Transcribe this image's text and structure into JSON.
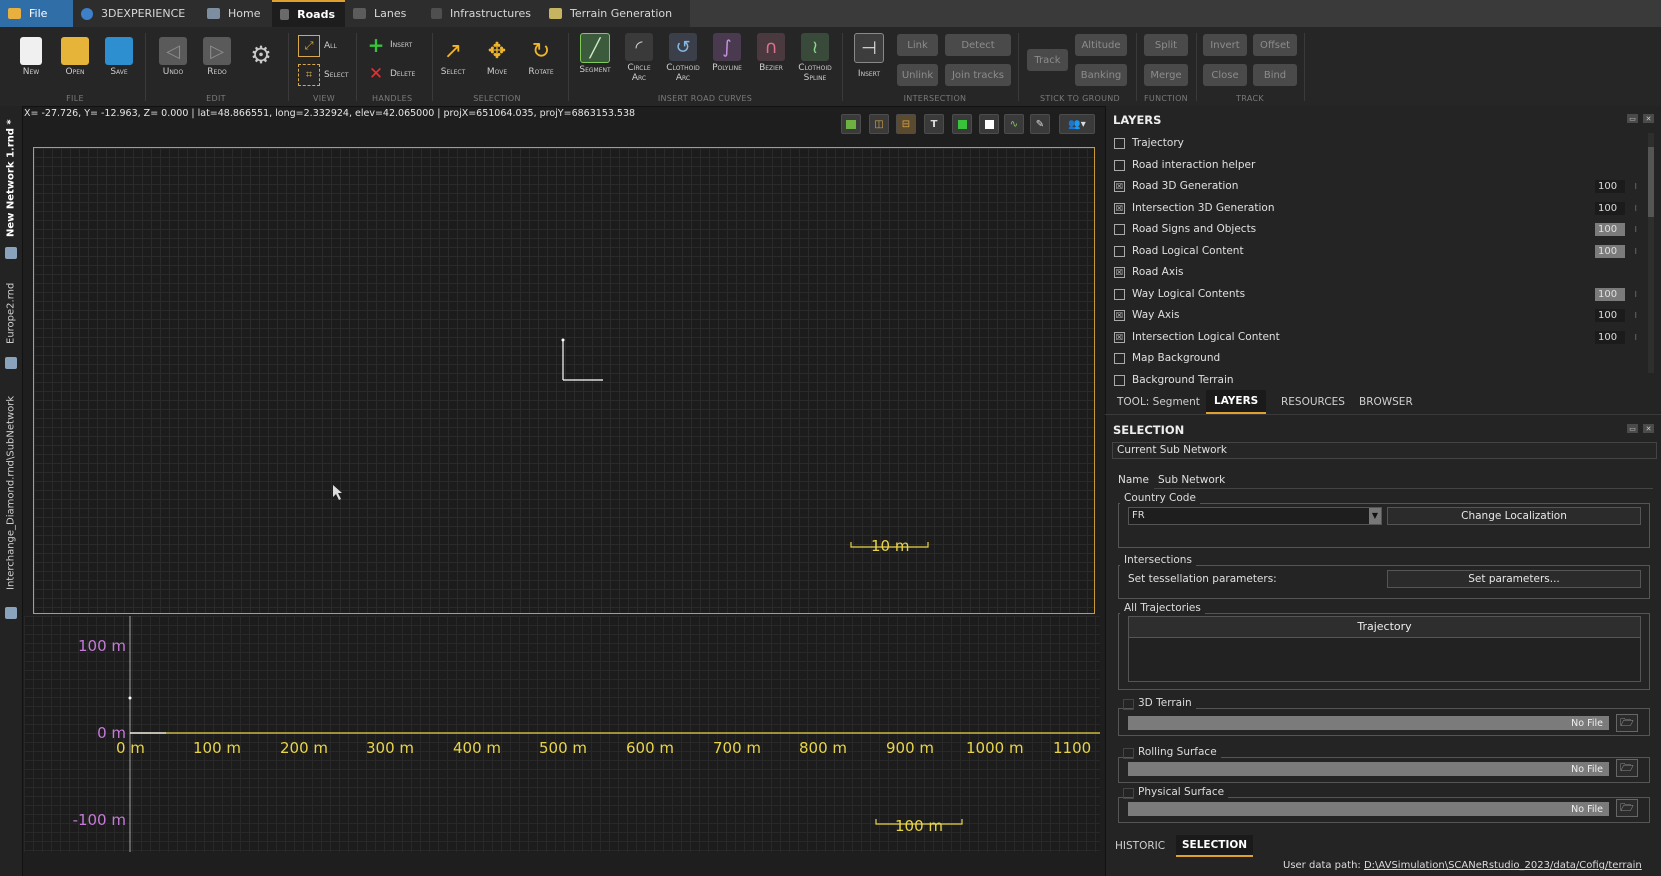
{
  "tabs": [
    {
      "label": "File"
    },
    {
      "label": "3DEXPERIENCE"
    },
    {
      "label": "Home"
    },
    {
      "label": "Roads"
    },
    {
      "label": "Lanes"
    },
    {
      "label": "Infrastructures"
    },
    {
      "label": "Terrain Generation"
    }
  ],
  "ribbon": {
    "file": {
      "new": "New",
      "open": "Open",
      "save": "Save",
      "group": "File"
    },
    "edit": {
      "undo": "Undo",
      "redo": "Redo",
      "group": "Edit"
    },
    "view": {
      "all": "All",
      "select": "Select",
      "group": "View"
    },
    "handles": {
      "insert": "Insert",
      "delete": "Delete",
      "group": "Handles"
    },
    "selection": {
      "select": "Select",
      "move": "Move",
      "rotate": "Rotate",
      "group": "Selection"
    },
    "curves": {
      "segment": "Segment",
      "circle_arc": "Circle Arc",
      "clothoid_arc": "Clothoid Arc",
      "polyline": "Polyline",
      "bezier": "Bezier",
      "clothoid_spline": "Clothoid Spline",
      "group": "Insert road curves"
    },
    "intersection": {
      "insert": "Insert",
      "link": "Link",
      "unlink": "Unlink",
      "detect": "Detect",
      "join_tracks": "Join tracks",
      "group": "Intersection"
    },
    "stick": {
      "track": "Track",
      "altitude": "Altitude",
      "banking": "Banking",
      "group": "Stick to ground"
    },
    "function": {
      "split": "Split",
      "merge": "Merge",
      "group": "Function"
    },
    "track": {
      "invert": "Invert",
      "offset": "Offset",
      "close": "Close",
      "bind": "Bind",
      "group": "Track"
    }
  },
  "coords": "X= -27.726, Y= -12.963, Z=   0.000 | lat=48.866551, long=2.332924, elev=42.065000 | projX=651064.035, projY=6863153.538",
  "left_tabs": [
    "New Network 1.rnd *",
    "Europe2.rnd",
    "Interchange_Diamond.rnd\\SubNetwork"
  ],
  "view2d": {
    "scale_label": "10 m"
  },
  "profile": {
    "y_labels": [
      "100 m",
      "0 m",
      "-100 m"
    ],
    "x_labels": [
      "0 m",
      "100 m",
      "200 m",
      "300 m",
      "400 m",
      "500 m",
      "600 m",
      "700 m",
      "800 m",
      "900 m",
      "1000 m",
      "1100"
    ],
    "scale_label": "100 m"
  },
  "layers": {
    "title": "LAYERS",
    "items": [
      {
        "label": "Trajectory",
        "checked": false,
        "value": ""
      },
      {
        "label": "Road interaction helper",
        "checked": false,
        "value": ""
      },
      {
        "label": "Road 3D Generation",
        "checked": true,
        "value": "100"
      },
      {
        "label": "Intersection 3D Generation",
        "checked": true,
        "value": "100"
      },
      {
        "label": "Road Signs and Objects",
        "checked": false,
        "value": "100"
      },
      {
        "label": "Road Logical Content",
        "checked": false,
        "value": "100"
      },
      {
        "label": "Road Axis",
        "checked": true,
        "value": ""
      },
      {
        "label": "Way Logical Contents",
        "checked": false,
        "value": "100"
      },
      {
        "label": "Way Axis",
        "checked": true,
        "value": "100"
      },
      {
        "label": "Intersection Logical Content",
        "checked": true,
        "value": "100"
      },
      {
        "label": "Map Background",
        "checked": false,
        "value": ""
      },
      {
        "label": "Background Terrain",
        "checked": false,
        "value": ""
      }
    ]
  },
  "panel_tabs": [
    "TOOL: Segment",
    "LAYERS",
    "RESOURCES",
    "BROWSER"
  ],
  "selection": {
    "title": "SELECTION",
    "current": "Current Sub Network",
    "name_label": "Name",
    "name_value": "Sub Network",
    "country_code_label": "Country Code",
    "country_code_value": "FR",
    "change_localization": "Change Localization",
    "intersections_label": "Intersections",
    "tessellation_label": "Set tessellation parameters:",
    "set_parameters": "Set parameters...",
    "all_trajectories": "All Trajectories",
    "trajectory_header": "Trajectory",
    "terrain_label": "3D Terrain",
    "rolling_label": "Rolling Surface",
    "physical_label": "Physical Surface",
    "no_file": "No File"
  },
  "bottom_tabs": [
    "HISTORIC",
    "SELECTION"
  ],
  "status": {
    "label": "User data path:",
    "path": "D:\\AVSimulation\\SCANeRstudio_2023/data/Cofig/terrain"
  }
}
